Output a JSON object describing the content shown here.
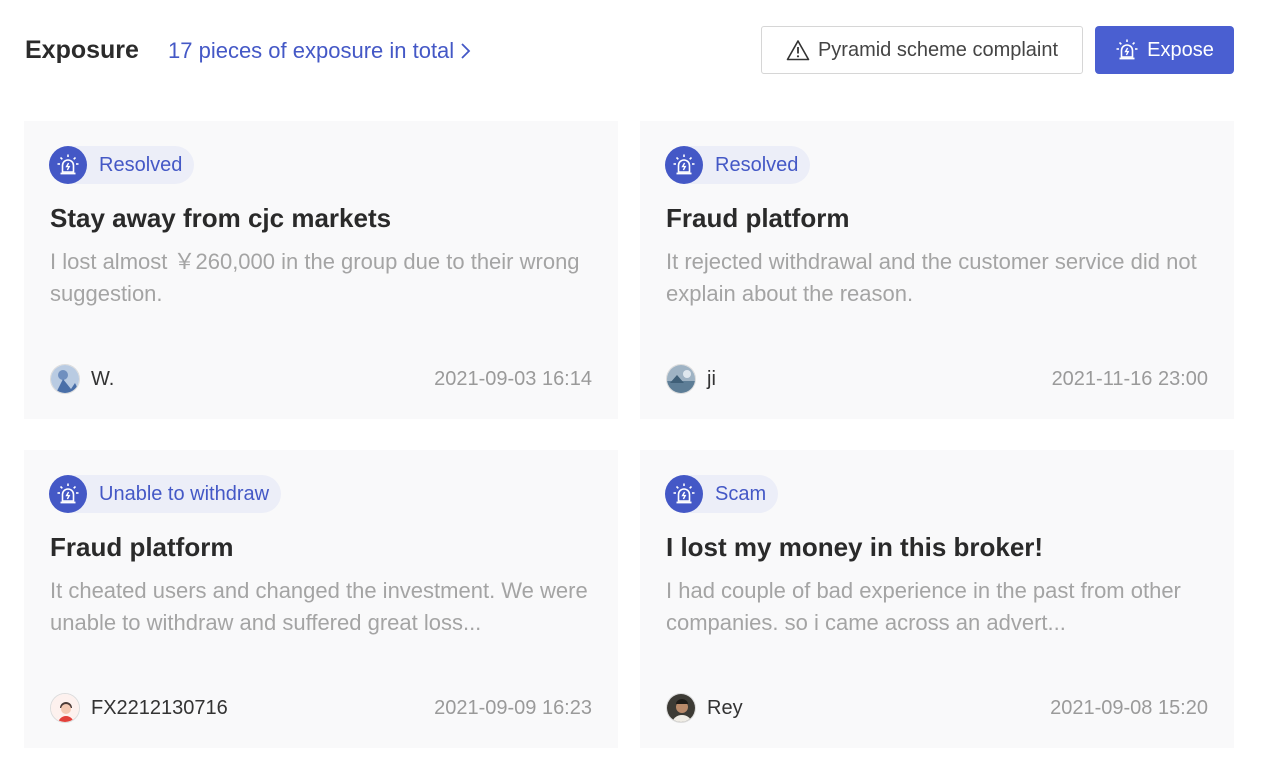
{
  "header": {
    "title": "Exposure",
    "total_link": "17 pieces of exposure in total",
    "complaint_button": "Pyramid scheme complaint",
    "expose_button": "Expose"
  },
  "colors": {
    "accent": "#4a5fd1",
    "tag_text": "#4458c6",
    "tag_bg": "#eceef8",
    "card_bg": "#f9f9fa"
  },
  "icons": {
    "chevron": "chevron-right-icon",
    "warning": "warning-triangle-icon",
    "alarm": "alarm-siren-icon"
  },
  "cards": [
    {
      "tag": "Resolved",
      "title": "Stay away from cjc markets",
      "description": "I lost almost ￥260,000 in the group due to their wrong suggestion.",
      "author": "W.",
      "date": "2021-09-03 16:14"
    },
    {
      "tag": "Resolved",
      "title": "Fraud platform",
      "description": "It rejected withdrawal and the customer service did not explain about the reason.",
      "author": "ji",
      "date": "2021-11-16 23:00"
    },
    {
      "tag": "Unable to withdraw",
      "title": "Fraud platform",
      "description": "It cheated users and changed the investment. We were unable to withdraw and suffered great loss...",
      "author": "FX2212130716",
      "date": "2021-09-09 16:23"
    },
    {
      "tag": "Scam",
      "title": "I lost my money in this broker!",
      "description": "I had couple of bad experience in the past from other companies. so i came across an advert...",
      "author": "Rey",
      "date": "2021-09-08 15:20"
    }
  ]
}
